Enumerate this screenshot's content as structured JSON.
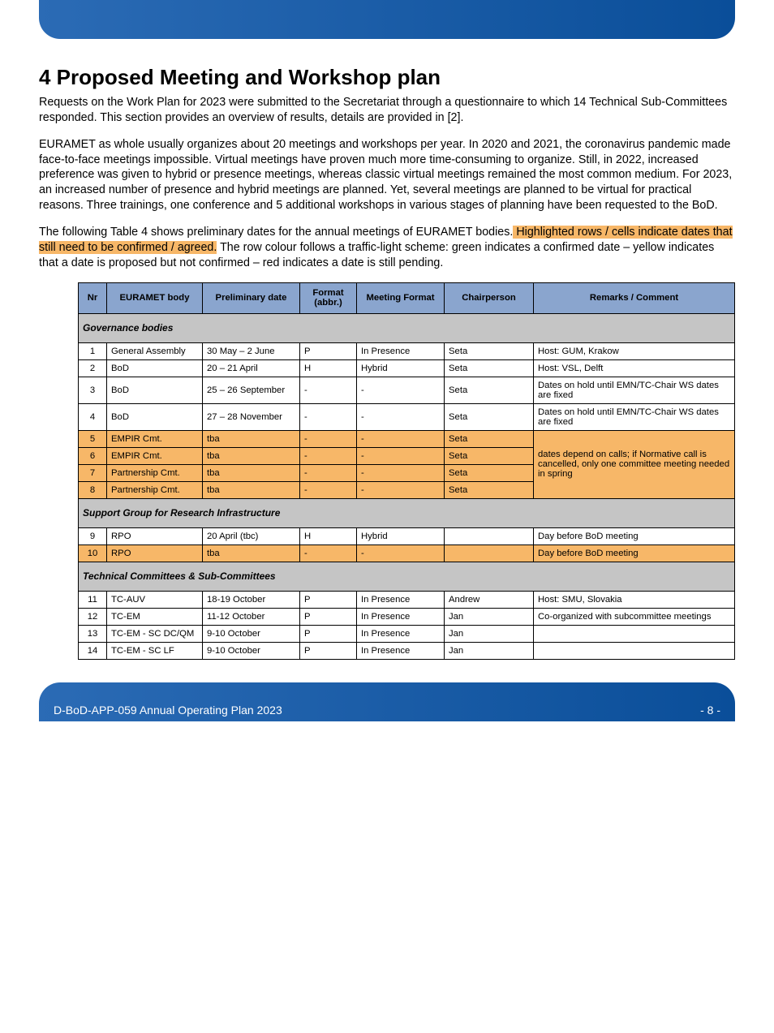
{
  "title": "4 Proposed Meeting and Workshop plan",
  "paragraphs": {
    "p1": "Requests on the Work Plan for 2023 were submitted to the Secretariat through a questionnaire to which 14 Technical Sub-Committees responded. This section provides an overview of results, details are provided in [2].",
    "p2": "EURAMET as whole usually organizes about 20 meetings and workshops per year. In 2020 and 2021, the coronavirus pandemic made face-to-face meetings impossible. Virtual meetings have proven much more time-consuming to organize. Still, in 2022, increased preference was given to hybrid or presence meetings, whereas classic virtual meetings remained the most common medium. For 2023, an increased number of presence and hybrid meetings are planned. Yet, several meetings are planned to be virtual for practical reasons. Three trainings, one conference and 5 additional workshops in various stages of planning have been requested to the BoD.",
    "p3_prefix": "The following Table 4 shows preliminary dates for the annual meetings of EURAMET bodies.",
    "p3_highlight": " Highlighted rows / cells indicate dates that still need to be confirmed / agreed.",
    "p3_suffix": " The row colour follows a traffic-light scheme: green indicates a confirmed date – yellow indicates that a date is proposed but not confirmed – red indicates a date is still pending."
  },
  "headers": {
    "nr": "Nr",
    "body": "EURAMET body",
    "date": "Preliminary date",
    "abbr": "Format (abbr.)",
    "format": "Meeting Format",
    "chair": "Chairperson",
    "remarks": "Remarks / Comment"
  },
  "section_titles": {
    "s1": "Governance bodies",
    "s2": "Support Group for Research Infrastructure",
    "s3": "Technical Committees & Sub-Committees"
  },
  "rows": {
    "r1": {
      "nr": "1",
      "body": "General Assembly",
      "date": "30 May – 2 June",
      "abbr": "P",
      "format": "In Presence",
      "chair": "Seta",
      "remarks": "Host: GUM, Krakow"
    },
    "r2": {
      "nr": "2",
      "body": "BoD",
      "date": "20 – 21 April",
      "abbr": "H",
      "format": "Hybrid",
      "chair": "Seta",
      "remarks": "Host: VSL, Delft"
    },
    "r3": {
      "nr": "3",
      "body": "BoD",
      "date": "25 – 26 September",
      "abbr": "-",
      "format": "-",
      "chair": "Seta",
      "remarks": "Dates on hold until EMN/TC-Chair WS dates are fixed"
    },
    "r4": {
      "nr": "4",
      "body": "BoD",
      "date": "27 – 28 November",
      "abbr": "-",
      "format": "-",
      "chair": "Seta",
      "remarks": "Dates on hold until EMN/TC-Chair WS dates are fixed"
    },
    "r5": {
      "nr": "5",
      "body": "EMPIR Cmt.",
      "date": "tba",
      "abbr": "-",
      "format": "-",
      "chair": "Seta",
      "remarks": ""
    },
    "r6": {
      "nr": "6",
      "body": "EMPIR Cmt.",
      "date": "tba",
      "abbr": "-",
      "format": "-",
      "chair": "Seta",
      "remarks": ""
    },
    "r7": {
      "nr": "7",
      "body": "Partnership Cmt.",
      "date": "tba",
      "abbr": "-",
      "format": "-",
      "chair": "Seta",
      "remarks": ""
    },
    "r8": {
      "nr": "8",
      "body": "Partnership Cmt.",
      "date": "tba",
      "abbr": "-",
      "format": "-",
      "chair": "Seta",
      "remarks": ""
    },
    "merged_note": "dates depend on calls; if Normative call is cancelled, only one committee meeting needed in spring",
    "r9": {
      "nr": "9",
      "body": "RPO",
      "date": "20 April (tbc)",
      "abbr": "H",
      "format": "Hybrid",
      "chair": "",
      "remarks": "Day before BoD meeting"
    },
    "r10": {
      "nr": "10",
      "body": "RPO",
      "date": "tba",
      "abbr": "-",
      "format": "-",
      "chair": "",
      "remarks": "Day before BoD meeting"
    },
    "r11": {
      "nr": "11",
      "body": "TC-AUV",
      "date": "18-19 October",
      "abbr": "P",
      "format": "In Presence",
      "chair": "Andrew",
      "remarks": "Host: SMU, Slovakia"
    },
    "r12": {
      "nr": "12",
      "body": "TC-EM",
      "date": "11-12 October",
      "abbr": "P",
      "format": "In Presence",
      "chair": "Jan",
      "remarks": "Co-organized with subcommittee meetings"
    },
    "r13": {
      "nr": "13",
      "body": "TC-EM - SC DC/QM",
      "date": "9-10 October",
      "abbr": "P",
      "format": "In Presence",
      "chair": "Jan",
      "remarks": ""
    },
    "r14": {
      "nr": "14",
      "body": "TC-EM - SC LF",
      "date": "9-10 October",
      "abbr": "P",
      "format": "In Presence",
      "chair": "Jan",
      "remarks": ""
    }
  },
  "footer": {
    "left": "D-BoD-APP-059 Annual Operating Plan 2023",
    "right": "- 8 -"
  }
}
